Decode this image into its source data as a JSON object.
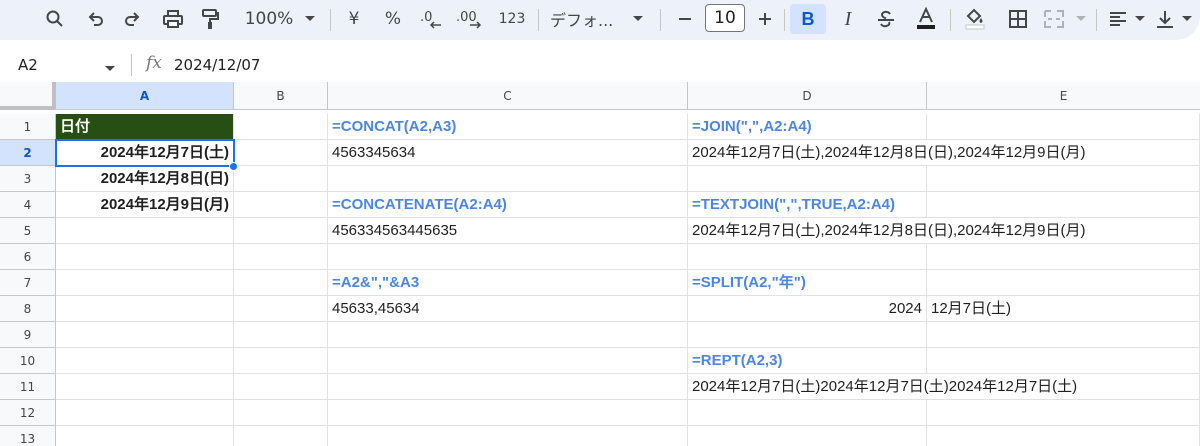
{
  "toolbar": {
    "zoom": "100%",
    "currency": "¥",
    "percent": "%",
    "number_format": "123",
    "font_name": "デフォ...",
    "font_size": "10",
    "icons": [
      "search-icon",
      "undo-icon",
      "redo-icon",
      "print-icon",
      "paint-format-icon",
      "decrease-decimal-icon",
      "increase-decimal-icon",
      "bold-icon",
      "italic-icon",
      "strikethrough-icon",
      "text-color-icon",
      "fill-color-icon",
      "borders-icon",
      "merge-cells-icon",
      "align-icon",
      "valign-icon"
    ],
    "colors": {
      "toolbar_bg": "#edf2fa",
      "active": "#d3e3fd"
    }
  },
  "formula_bar": {
    "cell_ref": "A2",
    "fx": "fx",
    "value": "2024/12/07"
  },
  "grid": {
    "columns": [
      "A",
      "B",
      "C",
      "D",
      "E"
    ],
    "rows": [
      "1",
      "2",
      "3",
      "4",
      "5",
      "6",
      "7",
      "8",
      "9",
      "10",
      "11",
      "12",
      "13"
    ],
    "cells": {
      "A1": "日付",
      "A2": "2024年12月7日(土)",
      "A3": "2024年12月8日(日)",
      "A4": "2024年12月9日(月)",
      "C1": "=CONCAT(A2,A3)",
      "C2": "4563345634",
      "C4": "=CONCATENATE(A2:A4)",
      "C5": "456334563445635",
      "C7": "=A2&\",\"&A3",
      "C8": "45633,45634",
      "D1": "=JOIN(\",\",A2:A4)",
      "D2": "2024年12月7日(土),2024年12月8日(日),2024年12月9日(月)",
      "D4": "=TEXTJOIN(\",\",TRUE,A2:A4)",
      "D5": "2024年12月7日(土),2024年12月8日(日),2024年12月9日(月)",
      "D7": "=SPLIT(A2,\"年\")",
      "D8": "2024",
      "E8": "12月7日(土)",
      "D10": "=REPT(A2,3)",
      "D11": "2024年12月7日(土)2024年12月7日(土)2024年12月7日(土)"
    },
    "colors": {
      "header_fill": "#274e13",
      "formula_text": "#4a86e8",
      "selection": "#1a73e8"
    }
  }
}
